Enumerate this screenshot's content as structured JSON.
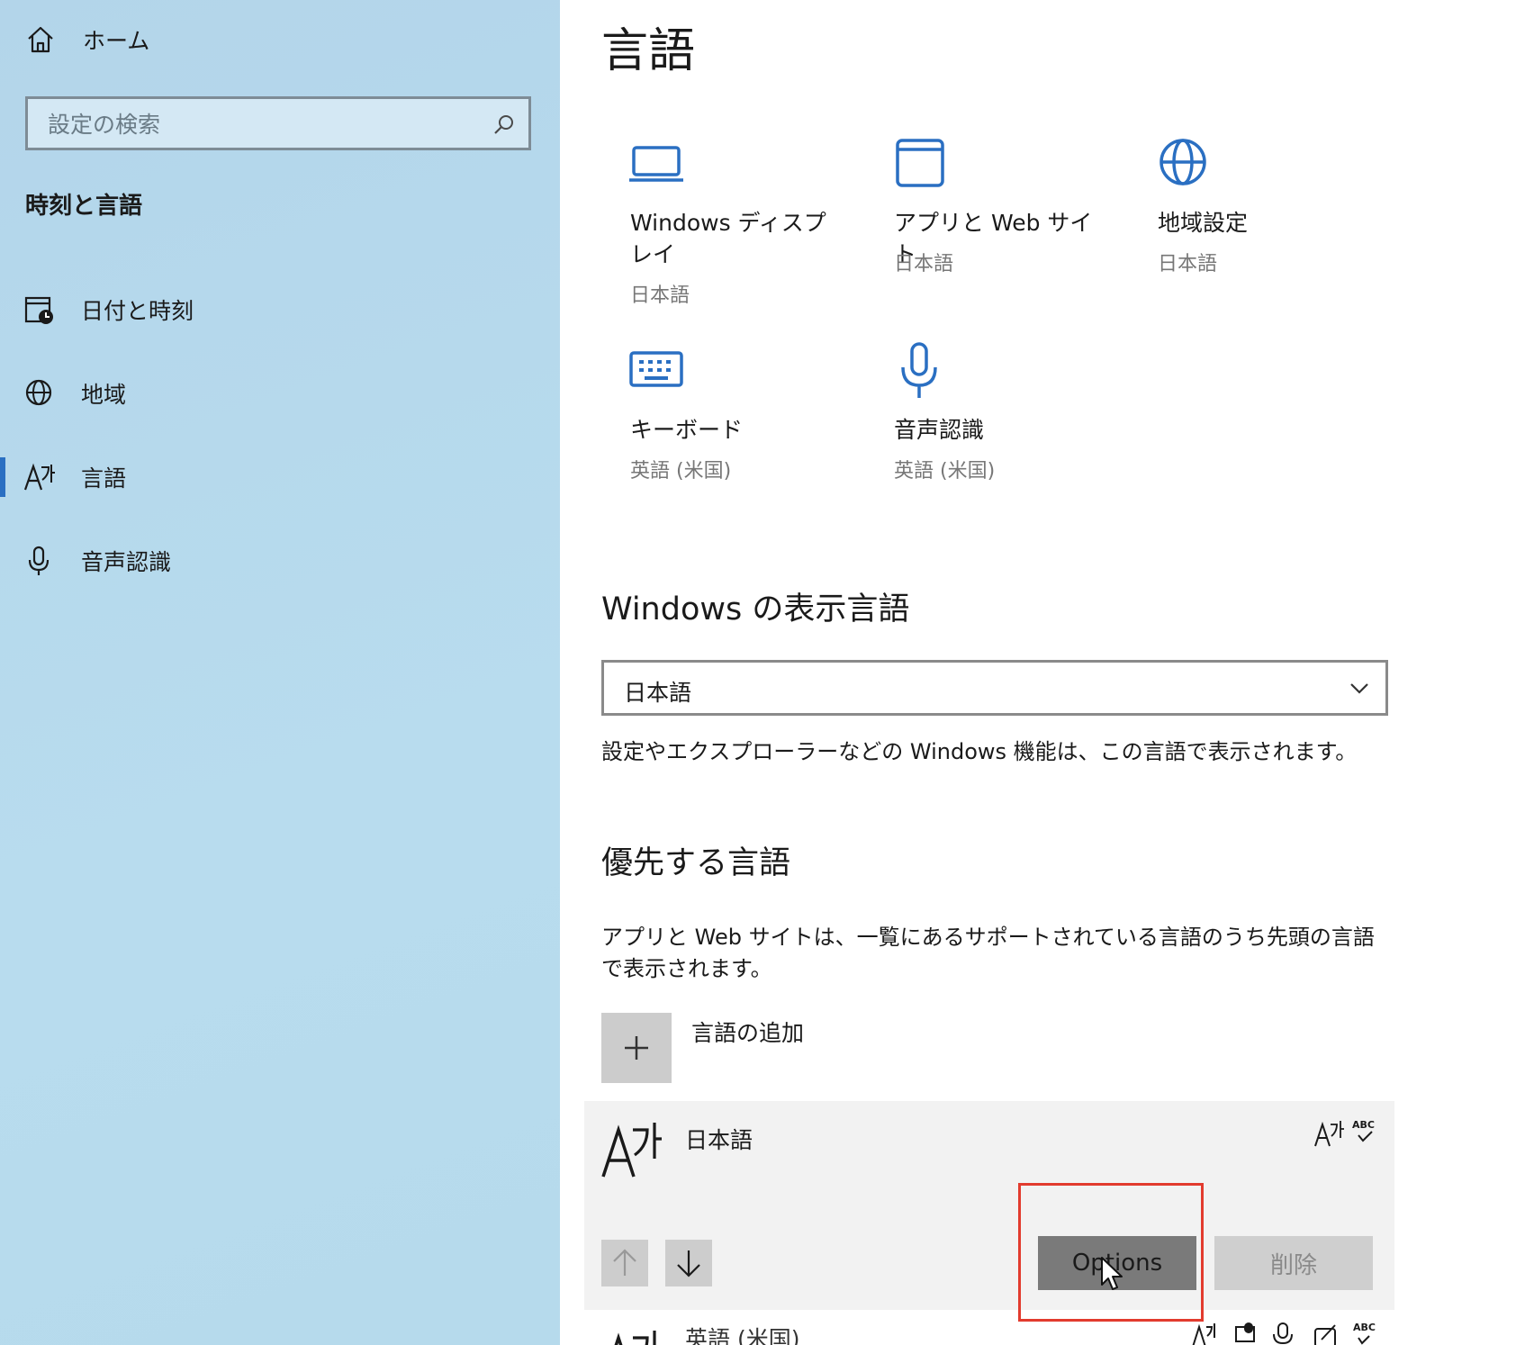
{
  "sidebar": {
    "home_label": "ホーム",
    "search_placeholder": "設定の検索",
    "section_title": "時刻と言語",
    "items": [
      {
        "label": "日付と時刻",
        "icon": "calendar-clock-icon"
      },
      {
        "label": "地域",
        "icon": "globe-icon"
      },
      {
        "label": "言語",
        "icon": "language-icon",
        "active": true
      },
      {
        "label": "音声認識",
        "icon": "microphone-icon"
      }
    ]
  },
  "main": {
    "title": "言語",
    "tiles": [
      {
        "name": "Windows ディスプレイ",
        "sub": "日本語",
        "icon": "laptop-icon"
      },
      {
        "name": "アプリと Web サイト",
        "sub": "日本語",
        "icon": "window-icon"
      },
      {
        "name": "地域設定",
        "sub": "日本語",
        "icon": "globe-icon"
      },
      {
        "name": "キーボード",
        "sub": "英語 (米国)",
        "icon": "keyboard-icon"
      },
      {
        "name": "音声認識",
        "sub": "英語 (米国)",
        "icon": "microphone-icon"
      }
    ],
    "display_language": {
      "heading": "Windows の表示言語",
      "selected": "日本語",
      "description": "設定やエクスプローラーなどの Windows 機能は、この言語で表示されます。"
    },
    "preferred": {
      "heading": "優先する言語",
      "description": "アプリと Web サイトは、一覧にあるサポートされている言語のうち先頭の言語で表示されます。",
      "add_label": "言語の追加",
      "languages": [
        {
          "name": "日本語",
          "options_label": "Options",
          "remove_label": "削除"
        },
        {
          "name": "英語 (米国)"
        }
      ]
    }
  },
  "colors": {
    "accent": "#2a6fc2",
    "sidebar_bg": "#b6d8ec",
    "highlight": "#e23b2e"
  }
}
